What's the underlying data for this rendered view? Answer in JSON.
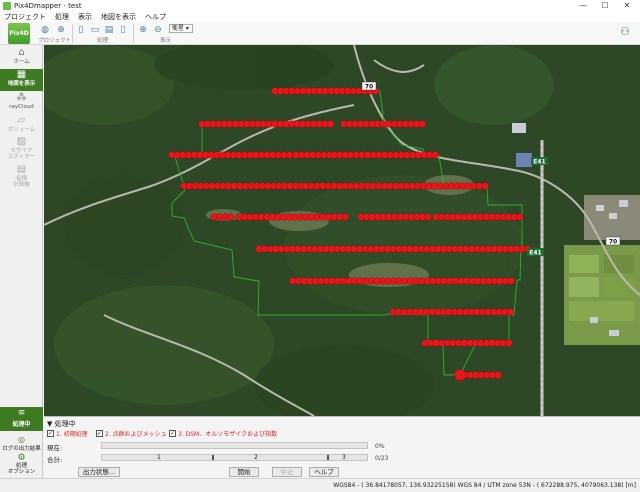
{
  "window": {
    "title": "Pix4Dmapper - test",
    "minimize": "—",
    "maximize": "☐",
    "close": "✕"
  },
  "menu": [
    "プロジェクト",
    "処理",
    "表示",
    "地図を表示",
    "ヘルプ"
  ],
  "toolbar": {
    "logo": "Pix4D",
    "groups": {
      "project": "プロジェクト",
      "process": "処理",
      "view": "表示"
    },
    "basemap_select": "衛星"
  },
  "sidebar": {
    "items": [
      {
        "label": "ホーム",
        "icon": "home-icon"
      },
      {
        "label": "地図を表示",
        "icon": "map-icon"
      },
      {
        "label": "rayCloud",
        "icon": "raycloud-icon"
      },
      {
        "label": "ボリューム",
        "icon": "volume-icon"
      },
      {
        "label": "モザイク\nエディター",
        "icon": "mosaic-icon"
      },
      {
        "label": "指標\n計算機",
        "icon": "index-calculator-icon"
      }
    ],
    "status_label": "処理中",
    "log_label": "ログの出力結果",
    "options_label": "処理\nオプション"
  },
  "map": {
    "road_labels": [
      {
        "text": "70"
      },
      {
        "text": "E41"
      },
      {
        "text": "E41"
      },
      {
        "text": "70"
      }
    ]
  },
  "processing": {
    "header": "処理中",
    "steps": [
      {
        "label": "1. 初期処理",
        "checked": true
      },
      {
        "label": "2. 点群およびメッシュ",
        "checked": true
      },
      {
        "label": "3. DSM、オルソモザイクおよび指数",
        "checked": true
      }
    ],
    "current_label": "現在:",
    "current_value": "0%",
    "current_progress": 0,
    "total_label": "合計:",
    "total_value": "0/23",
    "total_ticks": [
      "1",
      "2",
      "3"
    ],
    "total_progress": 0,
    "buttons": {
      "output_status": "出力状態...",
      "start": "開始",
      "cancel": "中止",
      "help": "ヘルプ"
    }
  },
  "statusbar": {
    "coords": "WGS84 - ( 36.84178057, 136.93225158) WGS 84 / UTM zone 53N - ( 672288.975, 4079063.138) [m]"
  },
  "colors": {
    "accent_green": "#3e7a22",
    "waypoint_red": "#e8151b",
    "flight_line": "#2bb52b"
  }
}
